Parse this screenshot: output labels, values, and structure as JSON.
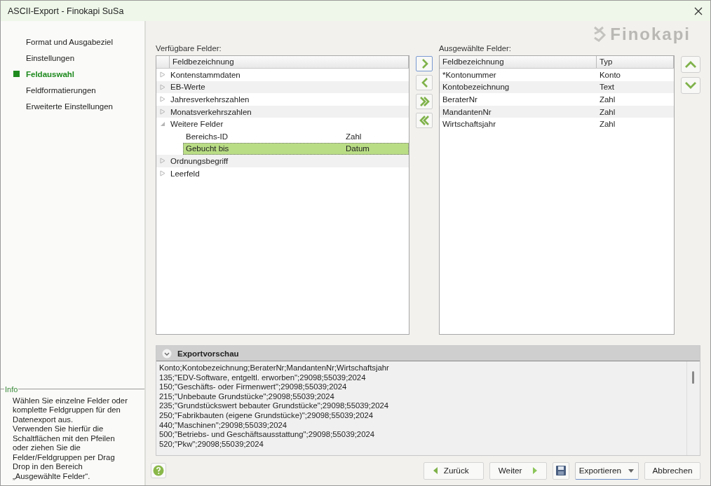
{
  "window": {
    "title": "ASCII-Export - Finokapi SuSa"
  },
  "steps": [
    {
      "label": "Format und Ausgabeziel",
      "selected": false
    },
    {
      "label": "Einstellungen",
      "selected": false
    },
    {
      "label": "Feldauswahl",
      "selected": true
    },
    {
      "label": "Feldformatierungen",
      "selected": false
    },
    {
      "label": "Erweiterte Einstellungen",
      "selected": false
    }
  ],
  "info": {
    "title": "Info",
    "text": "Wählen Sie einzelne Felder oder komplette Feldgruppen für den Datenexport aus.\nVerwenden Sie hierfür die Schaltflächen mit den Pfeilen oder ziehen Sie die Felder/Feldgruppen per Drag Drop in den Bereich „Ausgewählte Felder“."
  },
  "logo": "Finokapi",
  "available": {
    "label": "Verfügbare Felder:",
    "column": "Feldbezeichnung",
    "groups": [
      {
        "name": "Kontenstammdaten",
        "expanded": false
      },
      {
        "name": "EB-Werte",
        "expanded": false
      },
      {
        "name": "Jahresverkehrszahlen",
        "expanded": false
      },
      {
        "name": "Monatsverkehrszahlen",
        "expanded": false
      },
      {
        "name": "Weitere Felder",
        "expanded": true,
        "children": [
          {
            "name": "Bereichs-ID",
            "type": "Zahl",
            "selected": false
          },
          {
            "name": "Gebucht bis",
            "type": "Datum",
            "selected": true
          }
        ]
      },
      {
        "name": "Ordnungsbegriff",
        "expanded": false
      },
      {
        "name": "Leerfeld",
        "expanded": false
      }
    ]
  },
  "selected_fields": {
    "label": "Ausgewählte Felder:",
    "columns": [
      "Feldbezeichnung",
      "Typ"
    ],
    "rows": [
      [
        "*Kontonummer",
        "Konto"
      ],
      [
        "Kontobezeichnung",
        "Text"
      ],
      [
        "BeraterNr",
        "Zahl"
      ],
      [
        "MandantenNr",
        "Zahl"
      ],
      [
        "Wirtschaftsjahr",
        "Zahl"
      ]
    ]
  },
  "preview": {
    "title": "Exportvorschau",
    "lines": [
      "Konto;Kontobezeichnung;BeraterNr;MandantenNr;Wirtschaftsjahr",
      "135;\"EDV-Software, entgeltl. erworben\";29098;55039;2024",
      "150;\"Geschäfts- oder Firmenwert\";29098;55039;2024",
      "215;\"Unbebaute Grundstücke\";29098;55039;2024",
      "235;\"Grundstückswert bebauter Grundstücke\";29098;55039;2024",
      "250;\"Fabrikbauten (eigene Grundstücke)\";29098;55039;2024",
      "440;\"Maschinen\";29098;55039;2024",
      "500;\"Betriebs- und Geschäftsausstattung\";29098;55039;2024",
      "520;\"Pkw\";29098;55039;2024"
    ]
  },
  "buttons": {
    "back": "Zurück",
    "next": "Weiter",
    "export": "Exportieren",
    "cancel": "Abbrechen"
  }
}
